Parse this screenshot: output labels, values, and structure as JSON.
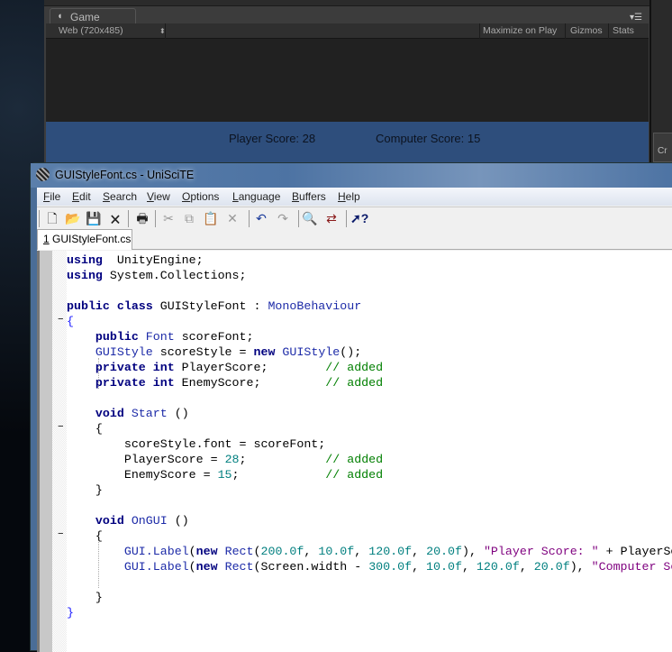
{
  "unity": {
    "tab_label": "Game",
    "resolution": "Web (720x485)",
    "buttons": [
      "Maximize on Play",
      "Gizmos",
      "Stats"
    ],
    "player_score": "Player Score: 28",
    "computer_score": "Computer Score: 15",
    "right_panel_text": "Cr"
  },
  "scite": {
    "title": "GUIStyleFont.cs - UniSciTE",
    "menu": [
      "File",
      "Edit",
      "Search",
      "View",
      "Options",
      "Language",
      "Buffers",
      "Help"
    ],
    "toolbar": [
      "new-file",
      "open",
      "save",
      "close",
      "print",
      "cut",
      "copy",
      "paste",
      "delete",
      "undo",
      "redo",
      "find",
      "replace",
      "help"
    ],
    "file_tab_index": "1",
    "file_tab": "GUIStyleFont.cs",
    "lines": [
      {
        "tokens": [
          [
            "kw",
            "using"
          ],
          [
            "",
            "  UnityEngine;"
          ]
        ]
      },
      {
        "tokens": [
          [
            "kw",
            "using"
          ],
          [
            "",
            " System.Collections;"
          ]
        ]
      },
      {
        "tokens": []
      },
      {
        "tokens": [
          [
            "kw",
            "public class"
          ],
          [
            "",
            " GUIStyleFont : "
          ],
          [
            "ty",
            "MonoBehaviour"
          ]
        ]
      },
      {
        "fold": true,
        "tokens": [
          [
            "br",
            "{"
          ]
        ]
      },
      {
        "tokens": [
          [
            "",
            "    "
          ],
          [
            "kw",
            "public"
          ],
          [
            "",
            " "
          ],
          [
            "ty",
            "Font"
          ],
          [
            "",
            " scoreFont;"
          ]
        ]
      },
      {
        "tokens": [
          [
            "",
            "    "
          ],
          [
            "ty",
            "GUIStyle"
          ],
          [
            "",
            " scoreStyle = "
          ],
          [
            "kw",
            "new"
          ],
          [
            "",
            " "
          ],
          [
            "ty",
            "GUIStyle"
          ],
          [
            "",
            "();"
          ]
        ]
      },
      {
        "tokens": [
          [
            "",
            "    "
          ],
          [
            "kw",
            "private int"
          ],
          [
            "",
            " PlayerScore;        "
          ],
          [
            "cmt",
            "// added"
          ]
        ]
      },
      {
        "tokens": [
          [
            "",
            "    "
          ],
          [
            "kw",
            "private int"
          ],
          [
            "",
            " EnemyScore;         "
          ],
          [
            "cmt",
            "// added"
          ]
        ]
      },
      {
        "tokens": []
      },
      {
        "tokens": [
          [
            "",
            "    "
          ],
          [
            "kw",
            "void"
          ],
          [
            "",
            " "
          ],
          [
            "ty",
            "Start"
          ],
          [
            "",
            " ()"
          ]
        ]
      },
      {
        "fold": true,
        "tokens": [
          [
            "",
            "    {"
          ]
        ]
      },
      {
        "tokens": [
          [
            "",
            "        scoreStyle.font = scoreFont;"
          ]
        ]
      },
      {
        "tokens": [
          [
            "",
            "        PlayerScore = "
          ],
          [
            "num",
            "28"
          ],
          [
            "",
            ";           "
          ],
          [
            "cmt",
            "// added"
          ]
        ]
      },
      {
        "tokens": [
          [
            "",
            "        EnemyScore = "
          ],
          [
            "num",
            "15"
          ],
          [
            "",
            ";            "
          ],
          [
            "cmt",
            "// added"
          ]
        ]
      },
      {
        "tokens": [
          [
            "",
            "    }"
          ]
        ]
      },
      {
        "tokens": []
      },
      {
        "tokens": [
          [
            "",
            "    "
          ],
          [
            "kw",
            "void"
          ],
          [
            "",
            " "
          ],
          [
            "ty",
            "OnGUI"
          ],
          [
            "",
            " ()"
          ]
        ]
      },
      {
        "fold": true,
        "tokens": [
          [
            "",
            "    {"
          ]
        ]
      },
      {
        "tokens": [
          [
            "",
            "        "
          ],
          [
            "ty",
            "GUI.Label"
          ],
          [
            "",
            "("
          ],
          [
            "kw",
            "new"
          ],
          [
            "",
            " "
          ],
          [
            "ty",
            "Rect"
          ],
          [
            "",
            "("
          ],
          [
            "num",
            "200.0f"
          ],
          [
            "",
            ", "
          ],
          [
            "num",
            "10.0f"
          ],
          [
            "",
            ", "
          ],
          [
            "num",
            "120.0f"
          ],
          [
            "",
            ", "
          ],
          [
            "num",
            "20.0f"
          ],
          [
            "",
            "), "
          ],
          [
            "str",
            "\"Player Score: \""
          ],
          [
            "",
            " + PlayerScore"
          ]
        ]
      },
      {
        "tokens": [
          [
            "",
            "        "
          ],
          [
            "ty",
            "GUI.Label"
          ],
          [
            "",
            "("
          ],
          [
            "kw",
            "new"
          ],
          [
            "",
            " "
          ],
          [
            "ty",
            "Rect"
          ],
          [
            "",
            "(Screen.width - "
          ],
          [
            "num",
            "300.0f"
          ],
          [
            "",
            ", "
          ],
          [
            "num",
            "10.0f"
          ],
          [
            "",
            ", "
          ],
          [
            "num",
            "120.0f"
          ],
          [
            "",
            ", "
          ],
          [
            "num",
            "20.0f"
          ],
          [
            "",
            "), "
          ],
          [
            "str",
            "\"Computer Score: \""
          ]
        ]
      },
      {
        "tokens": []
      },
      {
        "tokens": [
          [
            "",
            "    }"
          ]
        ]
      },
      {
        "tokens": [
          [
            "br",
            "}"
          ]
        ]
      }
    ]
  }
}
